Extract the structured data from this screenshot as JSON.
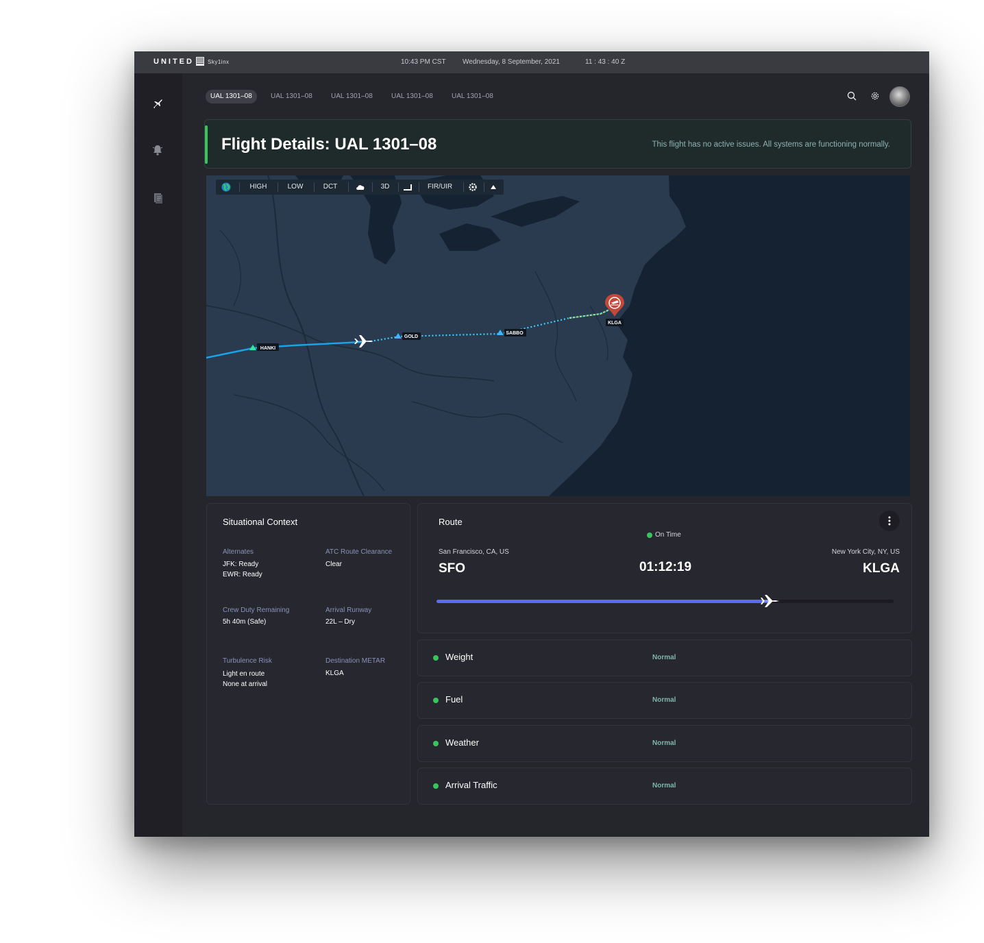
{
  "topbar": {
    "brand": "UNITED",
    "brand_sub": "Sky1inx",
    "time_local": "10:43 PM CST",
    "date": "Wednesday, 8 September, 2021",
    "time_zulu": "11 : 43 : 40 Z"
  },
  "sidebar": {
    "items": [
      {
        "icon": "airplane-icon"
      },
      {
        "icon": "bell-icon"
      },
      {
        "icon": "document-icon"
      }
    ]
  },
  "tabs": [
    "UAL 1301–08",
    "UAL 1301–08",
    "UAL 1301–08",
    "UAL 1301–08",
    "UAL 1301–08"
  ],
  "banner": {
    "title": "Flight Details: UAL 1301–08",
    "message": "This flight has no active issues. All systems are functioning normally.",
    "accent": "#38c55b"
  },
  "map_toolbar": {
    "items": [
      "HIGH",
      "LOW",
      "DCT",
      "3D",
      "FIR/UIR"
    ]
  },
  "map": {
    "waypoints": [
      "HANKI",
      "GOLD",
      "SABBO"
    ],
    "destination": "KLGA",
    "route_color": "#1aa3e8",
    "pending_route_color": "#c6e84a",
    "destination_color": "#c2493a"
  },
  "context": {
    "title": "Situational Context",
    "items": [
      {
        "label": "Alternates",
        "value": "JFK: Ready\nEWR: Ready"
      },
      {
        "label": "ATC Route Clearance",
        "value": "Clear"
      },
      {
        "label": "Crew Duty Remaining",
        "value": "5h 40m (Safe)"
      },
      {
        "label": "Arrival Runway",
        "value": "22L – Dry"
      },
      {
        "label": "Turbulence Risk",
        "value": "Light en route\nNone at arrival"
      },
      {
        "label": "Destination METAR",
        "value": "KLGA"
      }
    ]
  },
  "route": {
    "title": "Route",
    "status": "On Time",
    "origin_city": "San Francisco, CA, US",
    "origin_code": "SFO",
    "dest_city": "New York City, NY, US",
    "dest_code": "KLGA",
    "time_remaining": "01:12:19",
    "progress": 0.73,
    "progress_color": "#5b6cf0"
  },
  "status": [
    {
      "name": "Weight",
      "value": "Normal"
    },
    {
      "name": "Fuel",
      "value": "Normal"
    },
    {
      "name": "Weather",
      "value": "Normal"
    },
    {
      "name": "Arrival Traffic",
      "value": "Normal"
    }
  ]
}
